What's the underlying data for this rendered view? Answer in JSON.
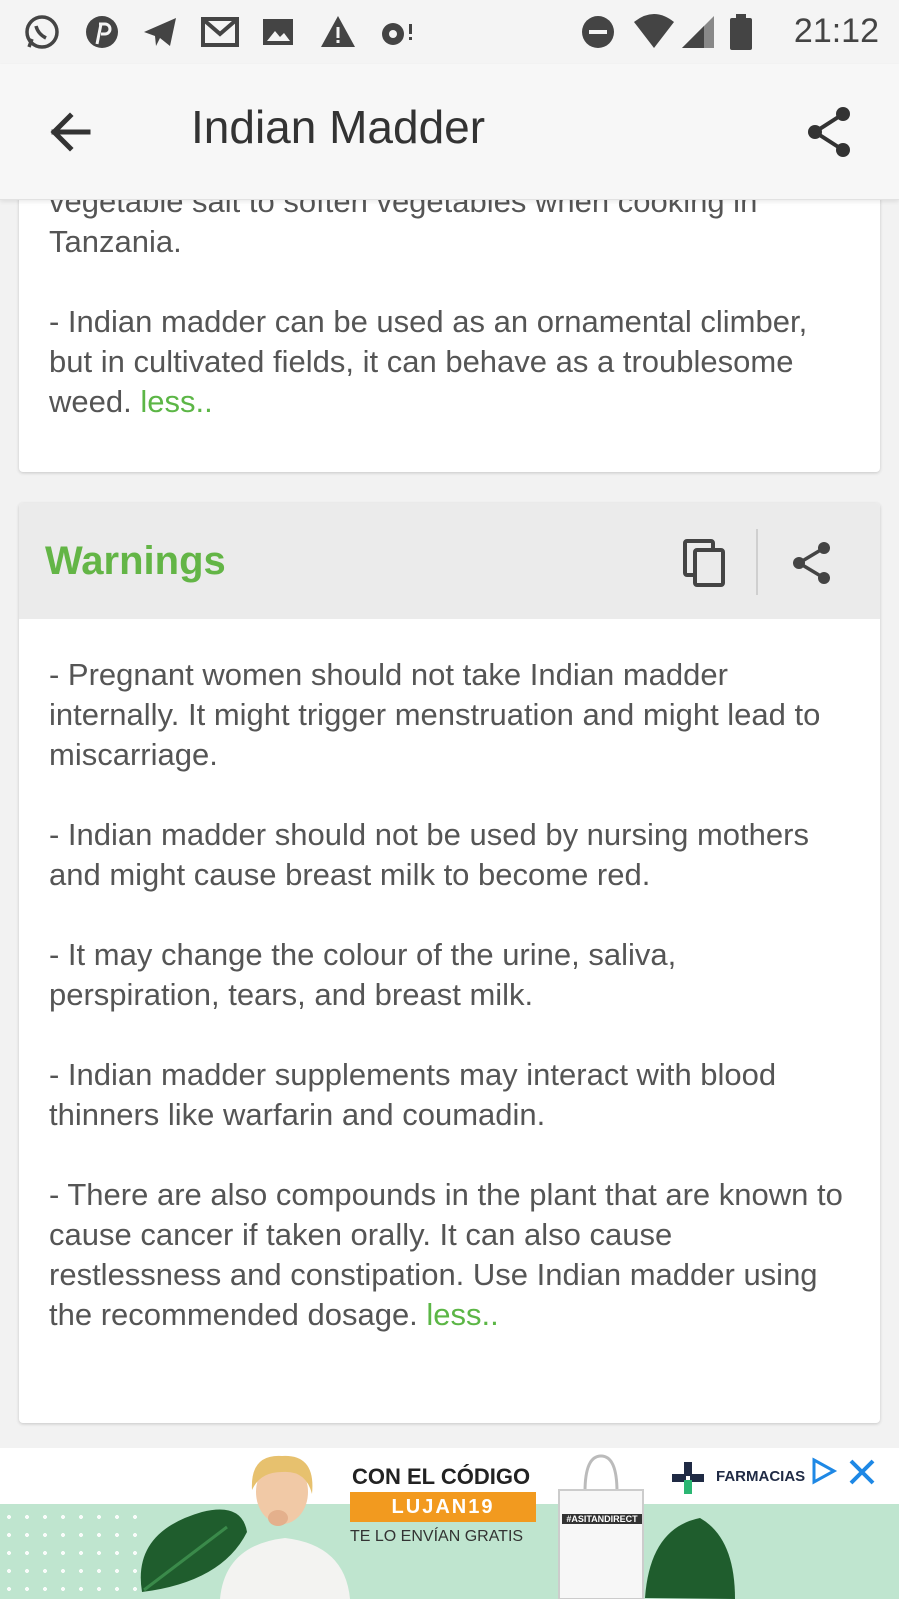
{
  "status_bar": {
    "time": "21:12",
    "icons": [
      "whatsapp-icon",
      "pinterest-icon",
      "telegram-icon",
      "gmail-icon",
      "gallery-icon",
      "warning-icon",
      "vpn-key-icon",
      "do-not-disturb-icon",
      "wifi-icon",
      "signal-icon",
      "battery-icon"
    ]
  },
  "app_bar": {
    "title": "Indian Madder",
    "back_icon": "arrow-back-icon",
    "share_icon": "share-icon"
  },
  "previous_section": {
    "paragraphs": [
      "vegetable salt to soften vegetables when cooking in Tanzania.",
      "- Indian madder can be used as an ornamental climber, but in cultivated fields, it can behave as a troublesome weed."
    ],
    "less_label": "less.."
  },
  "warnings_section": {
    "heading": "Warnings",
    "copy_icon": "copy-icon",
    "share_icon": "share-icon",
    "paragraphs": [
      "- Pregnant women should not take Indian madder internally. It might trigger menstruation and might lead to miscarriage.",
      "- Indian madder should not be used by nursing mothers and might cause breast milk to become red.",
      "- It may change the colour of the urine, saliva, perspiration, tears, and breast milk.",
      "- Indian madder supplements may interact with blood thinners like warfarin and coumadin.",
      "- There are also compounds in the plant that are known to cause cancer if taken orally. It can also cause restlessness and constipation. Use Indian madder using the recommended dosage."
    ],
    "less_label": "less.."
  },
  "ad_banner": {
    "headline": "CON EL CÓDIGO",
    "code": "LUJAN19",
    "subline": "TE LO ENVÍAN GRATIS",
    "brand": "FARMACIAS",
    "bag_label": "#ASITANDIRECT",
    "colors": {
      "strip": "#bfe5cf",
      "code_bg": "#f29a1f",
      "brand_blue": "#1e88e5"
    }
  },
  "colors": {
    "accent_green": "#63b546",
    "less_green": "#5cb646",
    "text": "#555555",
    "title": "#333333"
  }
}
